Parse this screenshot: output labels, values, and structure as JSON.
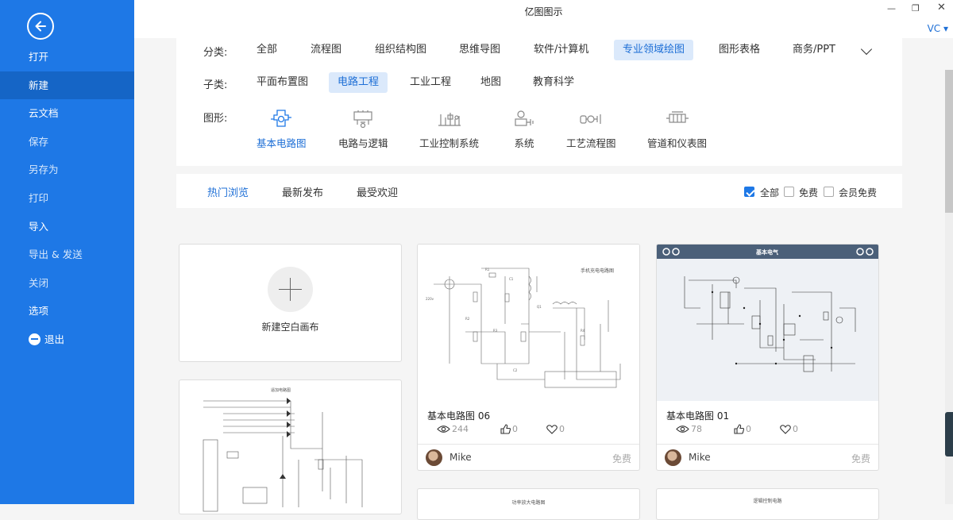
{
  "app": {
    "title": "亿图图示",
    "user": "VC ▾"
  },
  "sidebar": {
    "items": [
      {
        "label": "打开"
      },
      {
        "label": "新建"
      },
      {
        "label": "云文档"
      },
      {
        "label": "保存"
      },
      {
        "label": "另存为"
      },
      {
        "label": "打印"
      },
      {
        "label": "导入"
      },
      {
        "label": "导出 & 发送"
      },
      {
        "label": "关闭"
      },
      {
        "label": "选项"
      },
      {
        "label": "退出"
      }
    ]
  },
  "filters": {
    "category_label": "分类:",
    "categories": [
      "全部",
      "流程图",
      "组织结构图",
      "思维导图",
      "软件/计算机",
      "专业领域绘图",
      "图形表格",
      "商务/PPT"
    ],
    "subcategory_label": "子类:",
    "subcategories": [
      "平面布置图",
      "电路工程",
      "工业工程",
      "地图",
      "教育科学"
    ],
    "shape_label": "图形:",
    "shapes": [
      "基本电路图",
      "电路与逻辑",
      "工业控制系统",
      "系统",
      "工艺流程图",
      "管道和仪表图"
    ]
  },
  "tabs": [
    "热门浏览",
    "最新发布",
    "最受欢迎"
  ],
  "checkboxes": [
    {
      "label": "全部",
      "checked": true
    },
    {
      "label": "免费",
      "checked": false
    },
    {
      "label": "会员免费",
      "checked": false
    }
  ],
  "blank_card": {
    "label": "新建空白画布"
  },
  "templates": [
    {
      "name": "基本电路图 06",
      "views": "244",
      "likes": "0",
      "favorites": "0",
      "author": "Mike",
      "price": "免费",
      "thumb_title": "手机充电电路图"
    },
    {
      "name": "基本电路图 01",
      "views": "78",
      "likes": "0",
      "favorites": "0",
      "author": "Mike",
      "price": "免费",
      "thumb_title": "基本电气"
    },
    {
      "thumb_title": "逼加电路图"
    },
    {
      "thumb_title": "功率放大电路图"
    },
    {
      "thumb_title": "逻辑控制电路"
    }
  ],
  "colors": {
    "sidebar": "#1e78e6",
    "sidebar_active": "#1565c6",
    "accent": "#1e6fd6",
    "selected_chip_bg": "#dbe9fb"
  }
}
